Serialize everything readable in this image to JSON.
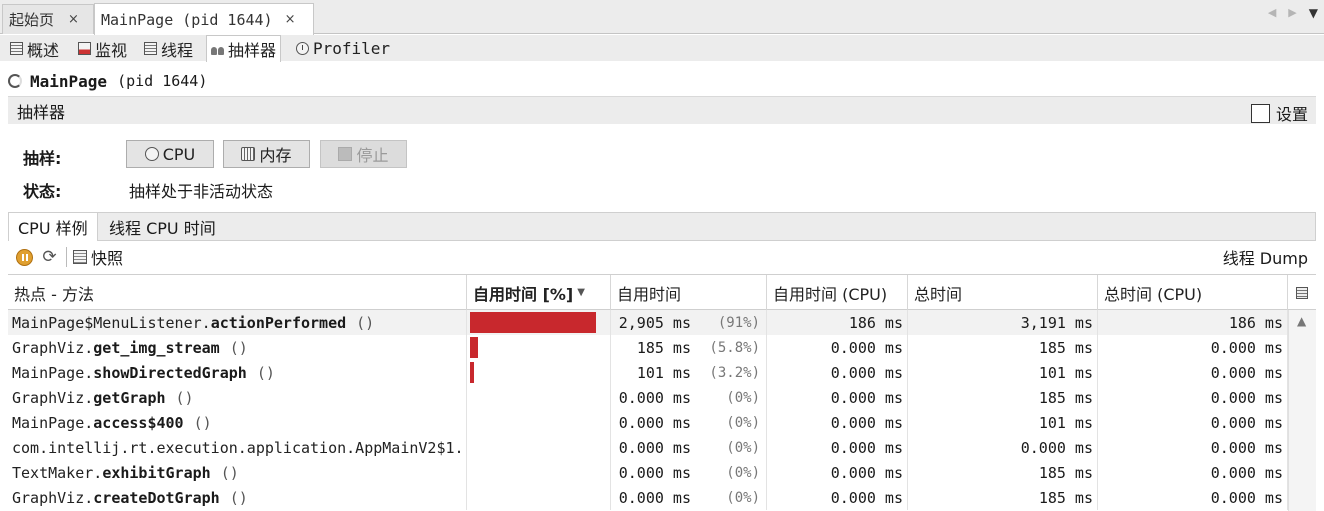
{
  "doc_tabs": [
    {
      "label": "起始页",
      "close": "×"
    },
    {
      "label": "MainPage (pid 1644)",
      "close": "×"
    }
  ],
  "view_tabs": [
    {
      "label": "概述",
      "icon": "overview-icon"
    },
    {
      "label": "监视",
      "icon": "monitor-icon"
    },
    {
      "label": "线程",
      "icon": "threads-icon"
    },
    {
      "label": "抽样器",
      "icon": "sampler-icon",
      "active": true
    },
    {
      "label": "Profiler",
      "icon": "profiler-icon"
    }
  ],
  "header": {
    "app_name": "MainPage",
    "pid": "(pid 1644)"
  },
  "section": {
    "title": "抽样器",
    "settings_label": "设置"
  },
  "sampling": {
    "label": "抽样:",
    "cpu_button": "CPU",
    "memory_button": "内存",
    "stop_button": "停止",
    "status_label": "状态:",
    "status_value": "抽样处于非活动状态"
  },
  "subtabs": [
    {
      "label": "CPU 样例",
      "active": true
    },
    {
      "label": "线程 CPU 时间"
    }
  ],
  "toolbar": {
    "snapshot_label": "快照",
    "thread_dump_label": "线程 Dump"
  },
  "table": {
    "columns": [
      "热点 - 方法",
      "自用时间 [%]",
      "自用时间",
      "自用时间 (CPU)",
      "总时间",
      "总时间 (CPU)"
    ],
    "rows": [
      {
        "cls": "MainPage$MenuListener.",
        "method": "actionPerformed",
        "args": "()",
        "self_pct": 91,
        "self_ms": "2,905 ms",
        "pct_text": "(91%)",
        "self_cpu": "186 ms",
        "total": "3,191 ms",
        "total_cpu": "186 ms"
      },
      {
        "cls": "GraphViz.",
        "method": "get_img_stream",
        "args": "()",
        "self_pct": 5.8,
        "self_ms": "185 ms",
        "pct_text": "(5.8%)",
        "self_cpu": "0.000 ms",
        "total": "185 ms",
        "total_cpu": "0.000 ms"
      },
      {
        "cls": "MainPage.",
        "method": "showDirectedGraph",
        "args": "()",
        "self_pct": 3.2,
        "self_ms": "101 ms",
        "pct_text": "(3.2%)",
        "self_cpu": "0.000 ms",
        "total": "101 ms",
        "total_cpu": "0.000 ms"
      },
      {
        "cls": "GraphViz.",
        "method": "getGraph",
        "args": "()",
        "self_pct": 0,
        "self_ms": "0.000 ms",
        "pct_text": "(0%)",
        "self_cpu": "0.000 ms",
        "total": "185 ms",
        "total_cpu": "0.000 ms"
      },
      {
        "cls": "MainPage.",
        "method": "access$400",
        "args": "()",
        "self_pct": 0,
        "self_ms": "0.000 ms",
        "pct_text": "(0%)",
        "self_cpu": "0.000 ms",
        "total": "101 ms",
        "total_cpu": "0.000 ms"
      },
      {
        "cls": "com.intellij.rt.execution.application.AppMainV2$1.:",
        "method": "",
        "args": "",
        "self_pct": 0,
        "self_ms": "0.000 ms",
        "pct_text": "(0%)",
        "self_cpu": "0.000 ms",
        "total": "0.000 ms",
        "total_cpu": "0.000 ms"
      },
      {
        "cls": "TextMaker.",
        "method": "exhibitGraph",
        "args": "()",
        "self_pct": 0,
        "self_ms": "0.000 ms",
        "pct_text": "(0%)",
        "self_cpu": "0.000 ms",
        "total": "185 ms",
        "total_cpu": "0.000 ms"
      },
      {
        "cls": "GraphViz.",
        "method": "createDotGraph",
        "args": "()",
        "self_pct": 0,
        "self_ms": "0.000 ms",
        "pct_text": "(0%)",
        "self_cpu": "0.000 ms",
        "total": "185 ms",
        "total_cpu": "0.000 ms"
      }
    ]
  },
  "colors": {
    "bar": "#c8282d",
    "accent_orange": "#e0a030"
  }
}
